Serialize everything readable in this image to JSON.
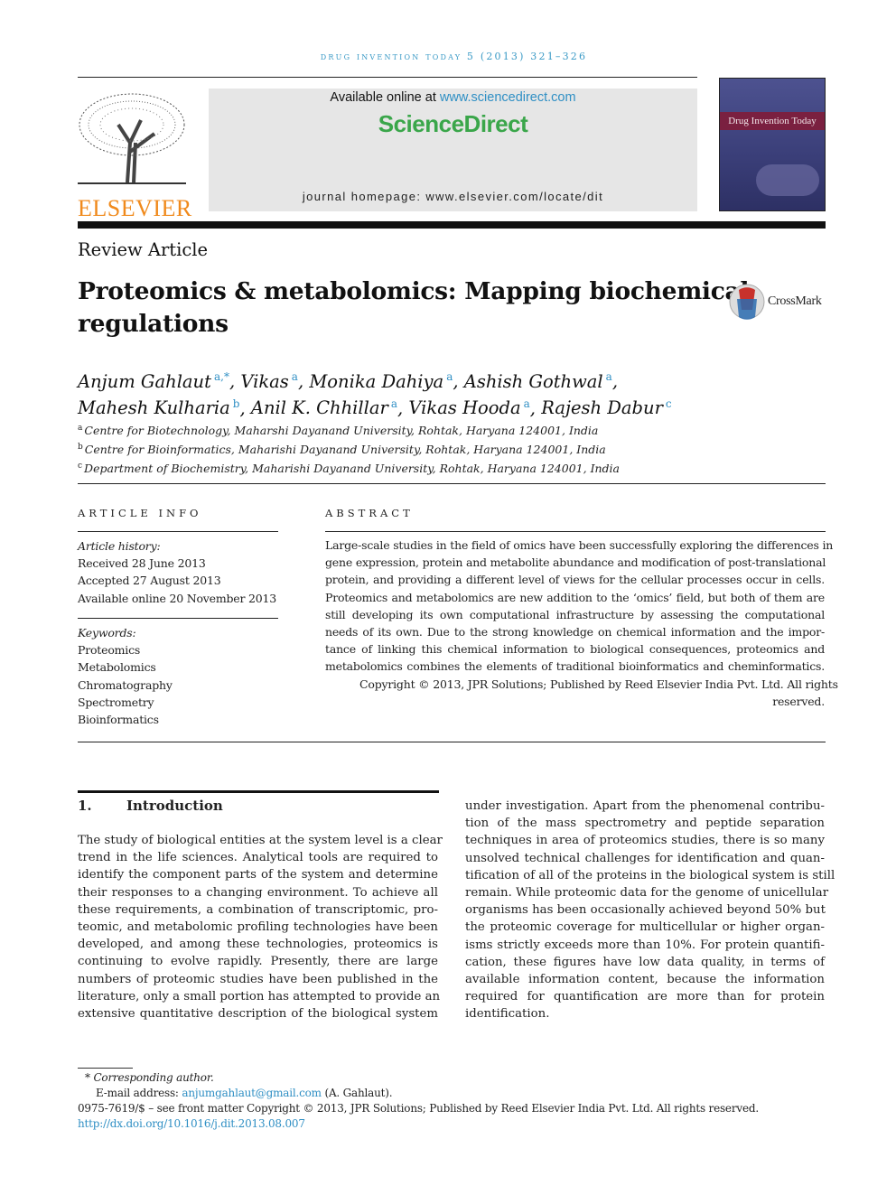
{
  "running_head": "drug invention today 5 (2013) 321–326",
  "header": {
    "available_prefix": "Available online at ",
    "available_link": "www.sciencedirect.com",
    "sciencedirect": "ScienceDirect",
    "homepage": "journal homepage: www.elsevier.com/locate/dit",
    "publisher_logo": "ELSEVIER",
    "cover_title": "Drug Invention Today",
    "colors": {
      "link": "#2f8fc4",
      "sciencedirect": "#3aa64a",
      "elsevier": "#f08a1c",
      "cover": "#4a4e8a",
      "cover_band": "#7a2040"
    }
  },
  "article_type": "Review Article",
  "title_lines": [
    "Proteomics & metabolomics: Mapping biochemical",
    "regulations"
  ],
  "crossmark": "CrossMark",
  "authors": [
    [
      {
        "name": "Anjum Gahlaut",
        "sup": "a,*"
      },
      {
        "name": "Vikas",
        "sup": "a"
      },
      {
        "name": "Monika Dahiya",
        "sup": "a"
      },
      {
        "name": "Ashish Gothwal",
        "sup": "a"
      }
    ],
    [
      {
        "name": "Mahesh Kulharia",
        "sup": "b"
      },
      {
        "name": "Anil K. Chhillar",
        "sup": "a"
      },
      {
        "name": "Vikas Hooda",
        "sup": "a"
      },
      {
        "name": "Rajesh Dabur",
        "sup": "c"
      }
    ]
  ],
  "affiliations": [
    {
      "sup": "a",
      "text": "Centre for Biotechnology, Maharshi Dayanand University, Rohtak, Haryana 124001, India"
    },
    {
      "sup": "b",
      "text": "Centre for Bioinformatics, Maharishi Dayanand University, Rohtak, Haryana 124001, India"
    },
    {
      "sup": "c",
      "text": "Department of Biochemistry, Maharishi Dayanand University, Rohtak, Haryana 124001, India"
    }
  ],
  "article_info": {
    "heading": "ARTICLE INFO",
    "history_label": "Article history:",
    "history": [
      "Received 28 June 2013",
      "Accepted 27 August 2013",
      "Available online 20 November 2013"
    ],
    "keywords_label": "Keywords:",
    "keywords": [
      "Proteomics",
      "Metabolomics",
      "Chromatography",
      "Spectrometry",
      "Bioinformatics"
    ]
  },
  "abstract": {
    "heading": "ABSTRACT",
    "lines": [
      "Large-scale studies in the field of omics have been successfully exploring the differences in",
      "gene expression, protein and metabolite abundance and modification of post-translational",
      "protein, and providing a different level of views for the cellular processes occur in cells.",
      "Proteomics and metabolomics are new addition to the ‘omics’ field, but both of them are",
      "still developing its own computational infrastructure by assessing the computational",
      "needs of its own. Due to the strong knowledge on chemical information and the impor-",
      "tance of linking this chemical information to biological consequences, proteomics and",
      "metabolomics combines the elements of traditional bioinformatics and cheminformatics.",
      "Copyright © 2013, JPR Solutions; Published by Reed Elsevier India Pvt. Ltd. All rights"
    ],
    "last": "reserved."
  },
  "section": {
    "number": "1.",
    "title": "Introduction"
  },
  "left_lines": [
    "The study of biological entities at the system level is a clear",
    "trend in the life sciences. Analytical tools are required to",
    "identify the component parts of the system and determine",
    "their responses to a changing environment. To achieve all",
    "these requirements, a combination of transcriptomic, pro-",
    "teomic, and metabolomic profiling technologies have been",
    "developed, and among these technologies, proteomics is",
    "continuing to evolve rapidly. Presently, there are large",
    "numbers of proteomic studies have been published in the",
    "literature, only a small portion has attempted to provide an",
    "extensive quantitative description of the biological system"
  ],
  "right_lines": [
    "under investigation. Apart from the phenomenal contribu-",
    "tion of the mass spectrometry and peptide separation",
    "techniques in area of proteomics studies, there is so many",
    "unsolved technical challenges for identification and quan-",
    "tification of all of the proteins in the biological system is still",
    "remain. While proteomic data for the genome of unicellular",
    "organisms has been occasionally achieved beyond 50% but",
    "the proteomic coverage for multicellular or higher organ-",
    "isms strictly exceeds more than 10%. For protein quantifi-",
    "cation, these figures have low data quality, in terms of",
    "available information content, because the information",
    "required for quantification are more than for protein"
  ],
  "right_last": "identification.",
  "footnote": {
    "star": "*",
    "corresponding": "Corresponding author.",
    "email_label": "E-mail address: ",
    "email": "anjumgahlaut@gmail.com",
    "email_suffix": " (A. Gahlaut).",
    "front_matter": "0975-7619/$ – see front matter Copyright © 2013, JPR Solutions; Published by Reed Elsevier India Pvt. Ltd. All rights reserved.",
    "doi": "http://dx.doi.org/10.1016/j.dit.2013.08.007"
  }
}
